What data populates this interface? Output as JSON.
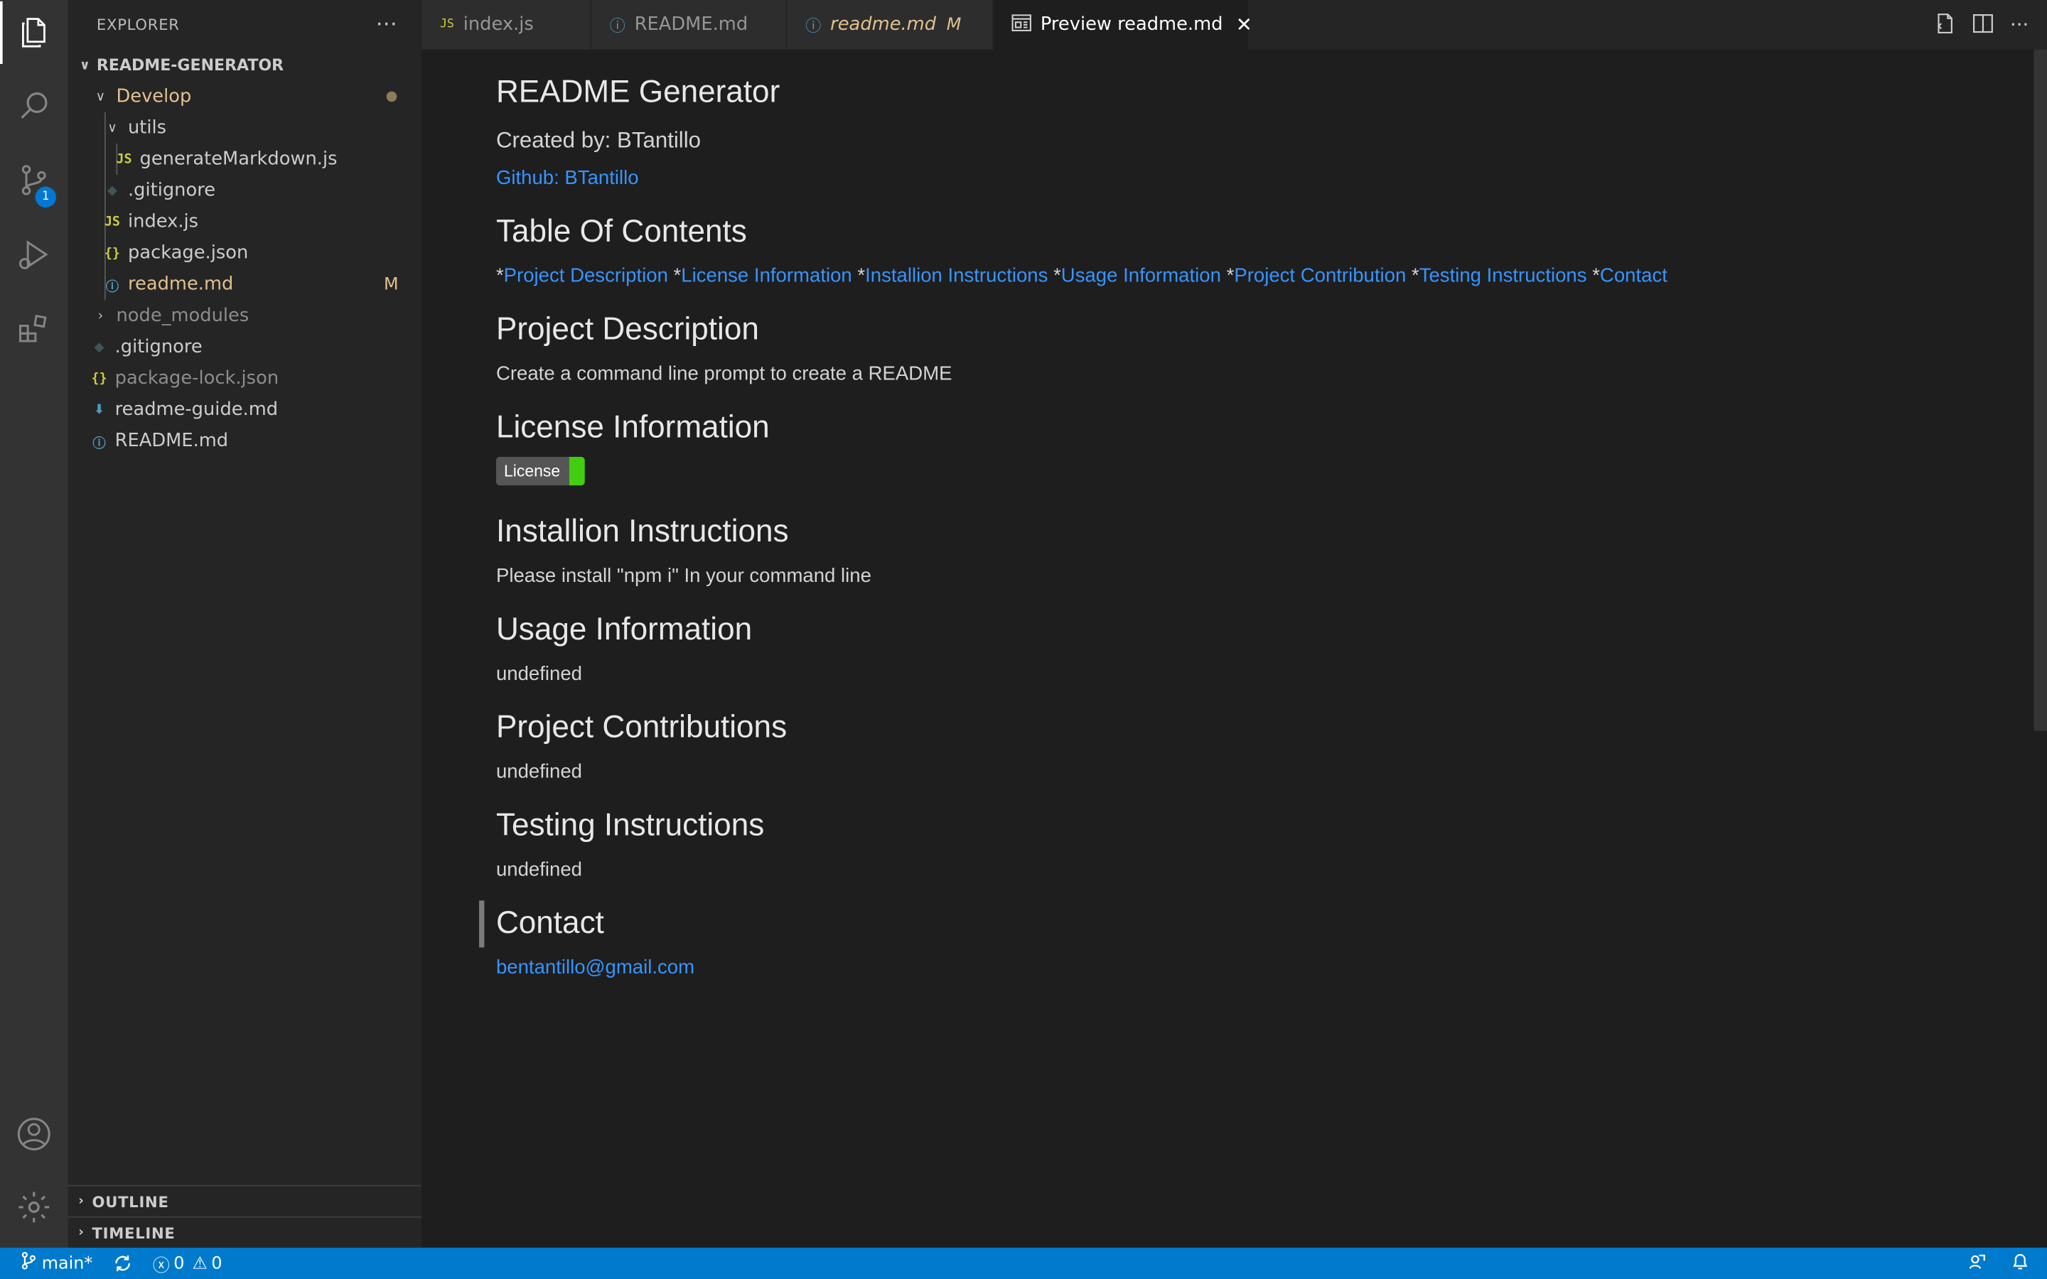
{
  "explorer": {
    "title": "EXPLORER",
    "more": "···",
    "root": "README-GENERATOR",
    "items": [
      {
        "label": "Develop",
        "type": "folder-open"
      },
      {
        "label": "utils",
        "type": "folder-open"
      },
      {
        "label": "generateMarkdown.js",
        "type": "js"
      },
      {
        "label": ".gitignore",
        "type": "git"
      },
      {
        "label": "index.js",
        "type": "js"
      },
      {
        "label": "package.json",
        "type": "json"
      },
      {
        "label": "readme.md",
        "type": "info",
        "status": "M"
      },
      {
        "label": "node_modules",
        "type": "folder-closed"
      },
      {
        "label": ".gitignore",
        "type": "git"
      },
      {
        "label": "package-lock.json",
        "type": "json"
      },
      {
        "label": "readme-guide.md",
        "type": "md"
      },
      {
        "label": "README.md",
        "type": "info"
      }
    ],
    "outline": "OUTLINE",
    "timeline": "TIMELINE"
  },
  "activity": {
    "scm_badge": "1"
  },
  "tabs": [
    {
      "label": "index.js",
      "icon": "JS"
    },
    {
      "label": "README.md",
      "icon": "ⓘ"
    },
    {
      "label": "readme.md",
      "icon": "ⓘ",
      "modified": "M"
    },
    {
      "label": "Preview readme.md",
      "icon": "preview"
    }
  ],
  "preview": {
    "title": "README Generator",
    "created_by": "Created by: BTantillo",
    "github": "Github: BTantillo",
    "toc_heading": "Table Of Contents",
    "toc": [
      {
        "star": "*",
        "label": "Project Description"
      },
      {
        "star": " *",
        "label": "License Information"
      },
      {
        "star": " *",
        "label": "Installion Instructions"
      },
      {
        "star": " *",
        "label": "Usage Information"
      },
      {
        "star": " *",
        "label": "Project Contribution"
      },
      {
        "star": " *",
        "label": "Testing Instructions"
      },
      {
        "star": " *",
        "label": "Contact"
      }
    ],
    "desc_heading": "Project Description",
    "desc_text": "Create a command line prompt to create a README",
    "license_heading": "License Information",
    "license_badge": "License",
    "install_heading": "Installion Instructions",
    "install_text": "Please install \"npm i\" In your command line",
    "usage_heading": "Usage Information",
    "usage_text": "undefined",
    "contrib_heading": "Project Contributions",
    "contrib_text": "undefined",
    "testing_heading": "Testing Instructions",
    "testing_text": "undefined",
    "contact_heading": "Contact",
    "contact_email": "bentantillo@gmail.com"
  },
  "status": {
    "branch": "main*",
    "errors": "0",
    "warnings": "0"
  }
}
